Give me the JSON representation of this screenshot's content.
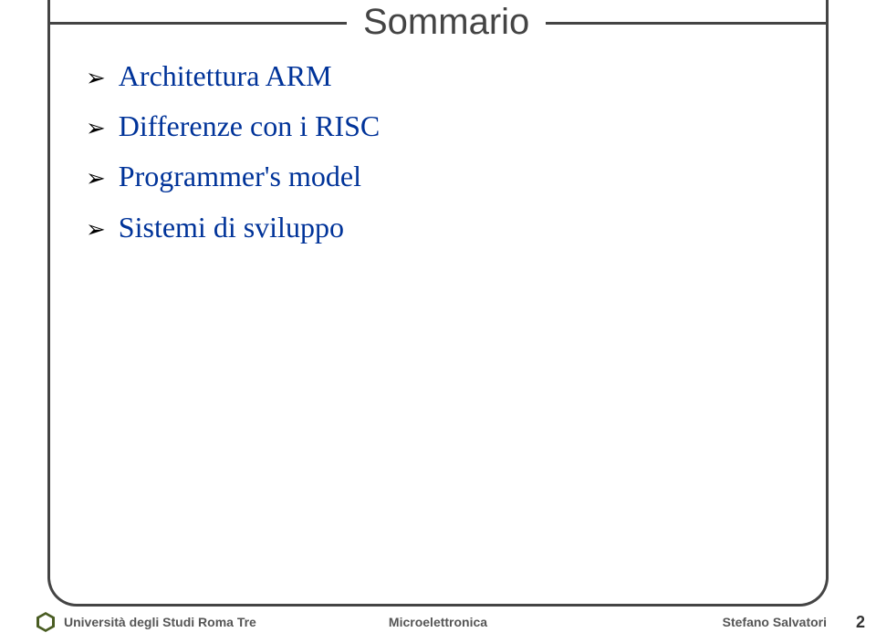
{
  "slide": {
    "title": "Sommario",
    "bullets": [
      {
        "text": "Architettura ARM"
      },
      {
        "text": "Differenze con i RISC"
      },
      {
        "text": "Programmer's model"
      },
      {
        "text": "Sistemi di sviluppo"
      }
    ]
  },
  "footer": {
    "university": "Università degli Studi Roma Tre",
    "course": "Microelettronica",
    "author": "Stefano Salvatori",
    "page_number": "2"
  }
}
